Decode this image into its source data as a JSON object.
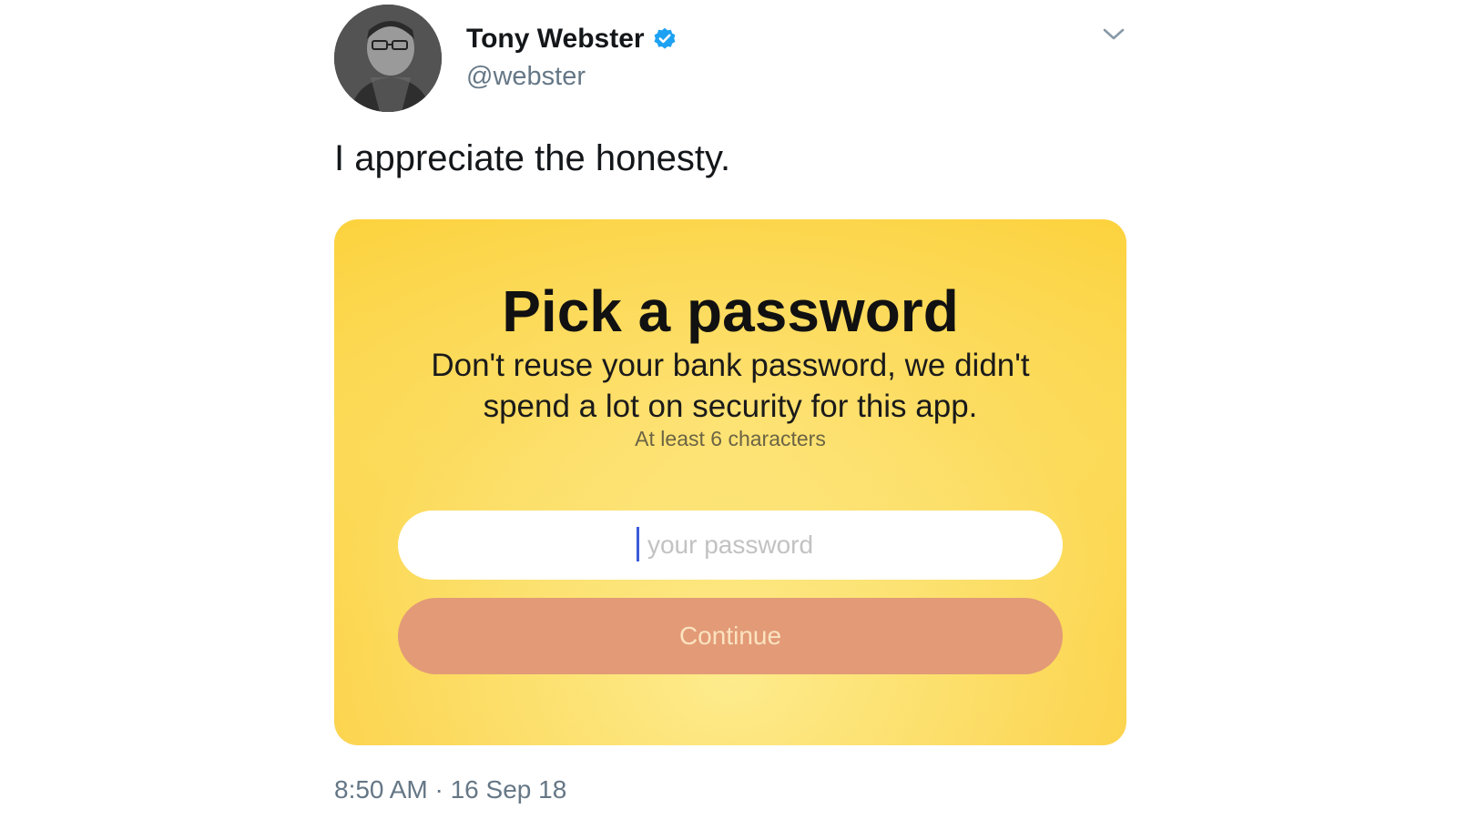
{
  "tweet": {
    "display_name": "Tony Webster",
    "handle": "@webster",
    "verified": true,
    "text": "I appreciate the honesty.",
    "timestamp": "8:50 AM · 16 Sep 18",
    "icons": {
      "avatar": "avatar",
      "verified": "verified-badge-icon",
      "menu": "chevron-down-icon"
    }
  },
  "card": {
    "title": "Pick a password",
    "subtitle_line1": "Don't reuse your bank password, we didn't",
    "subtitle_line2": "spend a lot on security for this app.",
    "hint": "At least 6 characters",
    "input": {
      "placeholder": "your password",
      "value": ""
    },
    "button_label": "Continue",
    "colors": {
      "background": "#fcd84e",
      "button": "#e39a77",
      "button_text": "#fbe3c0"
    }
  },
  "colors": {
    "verified": "#1da1f2",
    "secondary_text": "#657786"
  }
}
